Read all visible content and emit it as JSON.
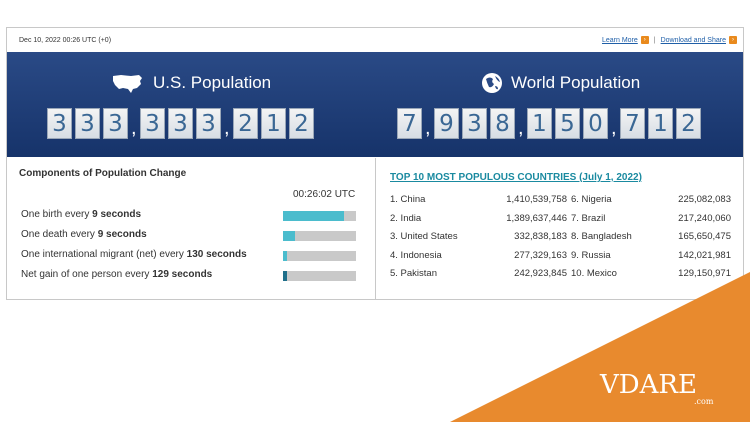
{
  "topbar": {
    "timestamp": "Dec 10, 2022 00:26 UTC (+0)",
    "learn_more": "Learn More",
    "separator": "|",
    "download_share": "Download and Share"
  },
  "us": {
    "title": "U.S. Population",
    "digits": [
      "3",
      "3",
      "3",
      ",",
      "3",
      "3",
      "3",
      ",",
      "2",
      "1",
      "2"
    ]
  },
  "world": {
    "title": "World Population",
    "digits": [
      "7",
      ",",
      "9",
      "3",
      "8",
      ",",
      "1",
      "5",
      "0",
      ",",
      "7",
      "1",
      "2"
    ]
  },
  "components": {
    "title": "Components of Population Change",
    "clock": "00:26:02 UTC",
    "rows": [
      {
        "pre": "One birth every ",
        "value": "9 seconds",
        "fill_fraction": 0.83,
        "color": "#4bbccd"
      },
      {
        "pre": "One death every ",
        "value": "9 seconds",
        "fill_fraction": 0.17,
        "color": "#4bbccd"
      },
      {
        "pre": "One international migrant (net) every ",
        "value": "130 seconds",
        "fill_fraction": 0.05,
        "color": "#4bbccd"
      },
      {
        "pre": "Net gain of one person every ",
        "value": "129 seconds",
        "fill_fraction": 0.06,
        "color": "#1f6f8a"
      }
    ]
  },
  "top10": {
    "title": "TOP 10 MOST POPULOUS COUNTRIES (July 1, 2022)",
    "countries": [
      {
        "rank_name": "1. China",
        "pop": "1,410,539,758"
      },
      {
        "rank_name": "2. India",
        "pop": "1,389,637,446"
      },
      {
        "rank_name": "3. United States",
        "pop": "332,838,183"
      },
      {
        "rank_name": "4. Indonesia",
        "pop": "277,329,163"
      },
      {
        "rank_name": "5. Pakistan",
        "pop": "242,923,845"
      },
      {
        "rank_name": "6. Nigeria",
        "pop": "225,082,083"
      },
      {
        "rank_name": "7. Brazil",
        "pop": "217,240,060"
      },
      {
        "rank_name": "8. Bangladesh",
        "pop": "165,650,475"
      },
      {
        "rank_name": "9. Russia",
        "pop": "142,021,981"
      },
      {
        "rank_name": "10. Mexico",
        "pop": "129,150,971"
      }
    ]
  },
  "watermark": {
    "logo": "VDARE",
    "domain": ".com"
  }
}
